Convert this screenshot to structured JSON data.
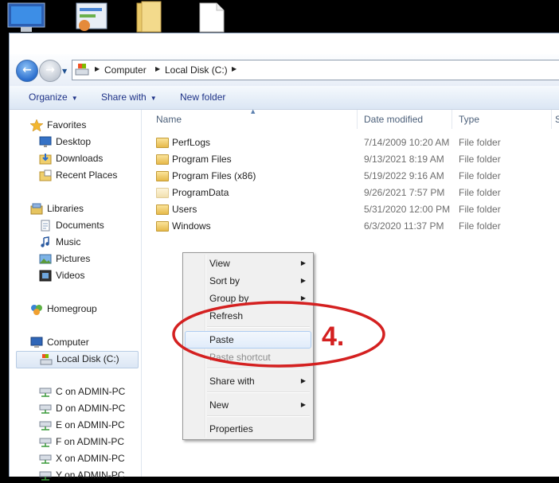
{
  "address": {
    "crumbs": [
      "Computer",
      "Local Disk (C:)"
    ]
  },
  "toolbar": {
    "organize_label": "Organize",
    "share_with_label": "Share with",
    "new_folder_label": "New folder"
  },
  "nav": {
    "favorites_label": "Favorites",
    "favorites": [
      "Desktop",
      "Downloads",
      "Recent Places"
    ],
    "libraries_label": "Libraries",
    "libraries": [
      "Documents",
      "Music",
      "Pictures",
      "Videos"
    ],
    "homegroup_label": "Homegroup",
    "computer_label": "Computer",
    "drives": [
      "Local Disk (C:)",
      "C on ADMIN-PC",
      "D on ADMIN-PC",
      "E on ADMIN-PC",
      "F on ADMIN-PC",
      "X on ADMIN-PC",
      "Y on ADMIN-PC"
    ]
  },
  "columns": {
    "name": "Name",
    "date": "Date modified",
    "type": "Type",
    "size_partial": "S"
  },
  "files": [
    {
      "name": "PerfLogs",
      "date": "7/14/2009 10:20 AM",
      "type": "File folder"
    },
    {
      "name": "Program Files",
      "date": "9/13/2021 8:19 AM",
      "type": "File folder"
    },
    {
      "name": "Program Files (x86)",
      "date": "5/19/2022 9:16 AM",
      "type": "File folder"
    },
    {
      "name": "ProgramData",
      "date": "9/26/2021 7:57 PM",
      "type": "File folder"
    },
    {
      "name": "Users",
      "date": "5/31/2020 12:00 PM",
      "type": "File folder"
    },
    {
      "name": "Windows",
      "date": "6/3/2020 11:37 PM",
      "type": "File folder"
    }
  ],
  "menu": {
    "view": "View",
    "sort_by": "Sort by",
    "group_by": "Group by",
    "refresh": "Refresh",
    "paste": "Paste",
    "paste_shortcut": "Paste shortcut",
    "share_with": "Share with",
    "new": "New",
    "properties": "Properties"
  },
  "annotation": {
    "step": "4.",
    "color": "#d42020"
  },
  "colors": {
    "toolbar_text": "#1e3287",
    "menu_bg": "#f0f0f0"
  }
}
